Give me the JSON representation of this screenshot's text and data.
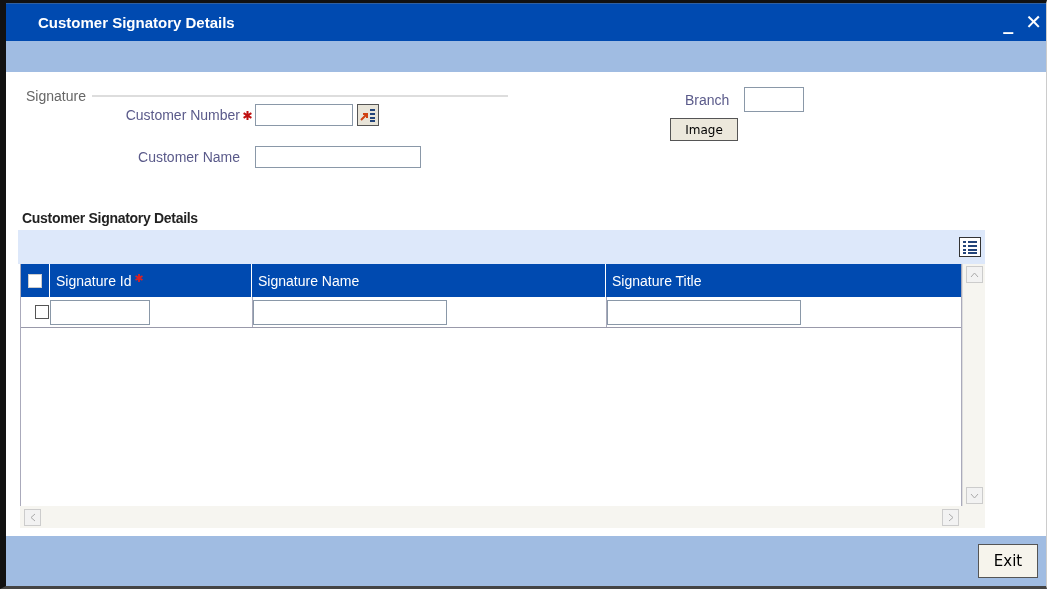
{
  "window": {
    "title": "Customer Signatory Details",
    "controls": [
      "_",
      "✕"
    ]
  },
  "signature": {
    "legend": "Signature",
    "fields": [
      {
        "label": "Customer Number",
        "required": true,
        "lookup": true
      },
      {
        "label": "Customer Name",
        "required": false,
        "lookup": false
      }
    ],
    "branch": {
      "label": "Branch"
    },
    "image_button": "Image"
  },
  "grid": {
    "title": "Customer Signatory Details",
    "header_checkbox": {
      "checked": false
    },
    "columns": [
      {
        "label": "Signature Id",
        "required": true
      },
      {
        "label": "Signature Name",
        "required": false
      },
      {
        "label": "Signature Title",
        "required": false
      }
    ],
    "rows": [
      {
        "checked": false
      }
    ]
  },
  "buttons": [
    "Exit"
  ]
}
